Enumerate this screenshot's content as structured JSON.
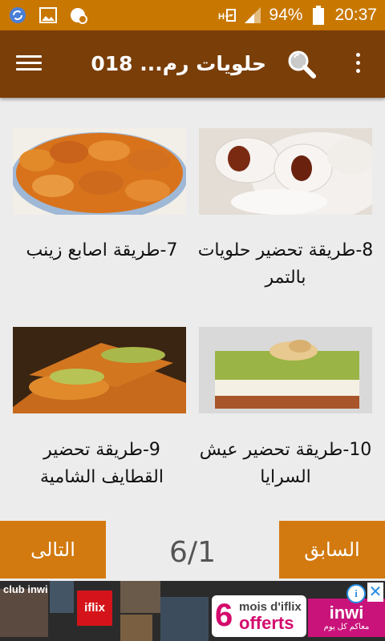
{
  "status_bar": {
    "battery": "94%",
    "time": "20:37",
    "icons": [
      "sync-icon",
      "image-icon",
      "notification-icon",
      "signal-icon",
      "sim-icon",
      "battery-icon"
    ]
  },
  "app_bar": {
    "title": "حلويات رم... 2018",
    "icons": [
      "menu-icon",
      "search-icon",
      "more-vert-icon"
    ]
  },
  "cards": [
    {
      "title": "8-طريقة تحضير حلويات بالتمر",
      "image": "date-pastries"
    },
    {
      "title": "7-طريقة اصابع زينب",
      "image": "fried-pastries"
    },
    {
      "title": "10-طريقة تحضير عيش السرايا",
      "image": "pistachio-dessert"
    },
    {
      "title": "9-طريقة تحضير القطايف الشامية",
      "image": "qatayef"
    }
  ],
  "navigation": {
    "previous_label": "السابق",
    "next_label": "التالى",
    "page_indicator": "6/1"
  },
  "ad": {
    "tag": "club inwi",
    "logo": "iflix",
    "offer_number": "6",
    "offer_line1": "mois d'iflix",
    "offer_line2": "offerts",
    "brand": "inwi",
    "brand_tagline": "معاكم كل يوم",
    "info_icon": "i",
    "close_icon": "✕"
  },
  "colors": {
    "status_bar": "#c87800",
    "app_bar": "#7a3e08",
    "accent": "#d27a10",
    "background": "#ececec"
  }
}
